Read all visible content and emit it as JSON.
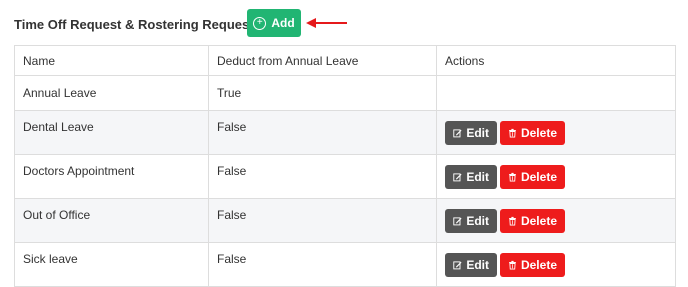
{
  "header": {
    "title": "Time Off Request & Rostering Request Types",
    "add_label": "Add",
    "plus_icon": "plus-circle-icon",
    "arrow_icon": "red-arrow-left-icon",
    "colors": {
      "add": "#21b573",
      "arrow": "#e5191b",
      "edit": "#555555",
      "delete": "#ee1c1c"
    }
  },
  "table": {
    "columns": [
      "Name",
      "Deduct from Annual Leave",
      "Actions"
    ],
    "rows": [
      {
        "name": "Annual Leave",
        "deduct": "True",
        "has_actions": false
      },
      {
        "name": "Dental Leave",
        "deduct": "False",
        "has_actions": true,
        "edit": "Edit",
        "delete": "Delete"
      },
      {
        "name": "Doctors Appointment",
        "deduct": "False",
        "has_actions": true,
        "edit": "Edit",
        "delete": "Delete"
      },
      {
        "name": "Out of Office",
        "deduct": "False",
        "has_actions": true,
        "edit": "Edit",
        "delete": "Delete"
      },
      {
        "name": "Sick leave",
        "deduct": "False",
        "has_actions": true,
        "edit": "Edit",
        "delete": "Delete"
      }
    ]
  }
}
